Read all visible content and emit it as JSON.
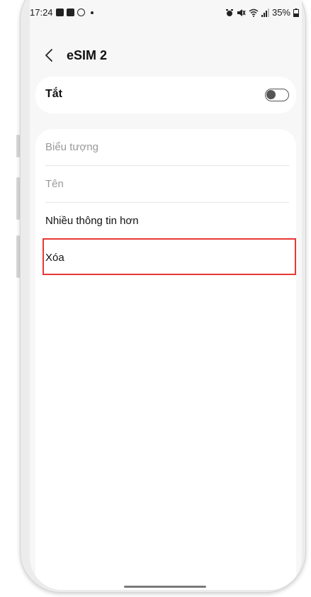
{
  "status_bar": {
    "time": "17:24",
    "battery": "35%"
  },
  "header": {
    "title": "eSIM 2",
    "back_icon": "chevron-left-icon"
  },
  "toggle_row": {
    "label": "Tắt",
    "state": "off"
  },
  "list": {
    "items": [
      {
        "label": "Biểu tượng",
        "enabled": false
      },
      {
        "label": "Tên",
        "enabled": false
      },
      {
        "label": "Nhiều thông tin hơn",
        "enabled": true
      },
      {
        "label": "Xóa",
        "enabled": true
      }
    ]
  },
  "colors": {
    "highlight": "#e53935",
    "background": "#f7f7f7",
    "card": "#ffffff",
    "disabled_text": "#9a9a9a"
  }
}
